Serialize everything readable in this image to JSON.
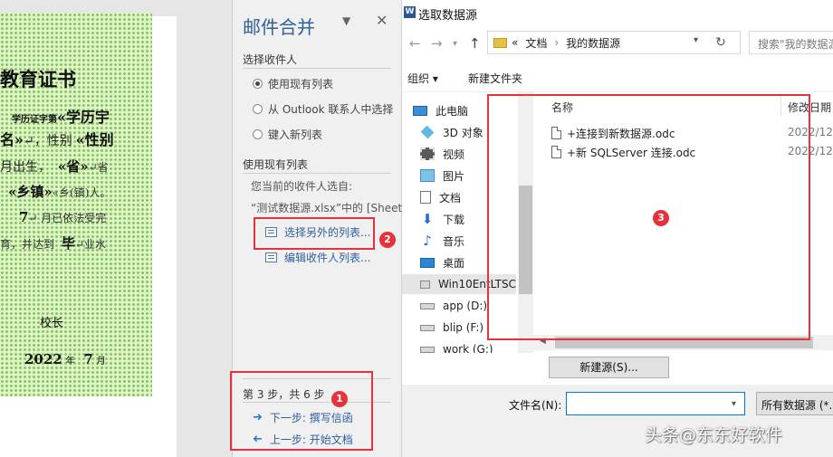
{
  "document": {
    "lines": [
      "教育证书",
      "学历证字第",
      "«学历宇",
      "名»",
      "↵，性别",
      "«性别",
      "月出生，",
      "«省»",
      "↵省",
      "«乡镇»",
      "«乡(镇)人。",
      "7",
      "↵ 月已依法受完",
      "育，并达到",
      "毕",
      "↵业水",
      "校长",
      "2022",
      "年",
      "7",
      "月"
    ]
  },
  "mail_merge": {
    "title": "邮件合并",
    "menu_icon": "chevron-down-icon",
    "close_label": "✕",
    "section_recipients": "选择收件人",
    "radio_options": [
      {
        "label": "使用现有列表",
        "selected": true
      },
      {
        "label": "从 Outlook 联系人中选择",
        "selected": false
      },
      {
        "label": "键入新列表",
        "selected": false
      }
    ],
    "section_existing": "使用现有列表",
    "current_from": "您当前的收件人选自:",
    "current_source": "“测试数据源.xlsx”中的 [Sheet1$",
    "select_other": "选择另外的列表...",
    "edit_list": "编辑收件人列表...",
    "step": "第 3 步，共 6 步",
    "next": "下一步: 撰写信函",
    "prev": "上一步: 开始文档"
  },
  "dialog": {
    "title": "选取数据源",
    "app_icon_letter": "W",
    "address": {
      "root": "«",
      "segments": [
        "文档",
        "我的数据源"
      ]
    },
    "search_placeholder": "搜索\"我的数据源\"",
    "organize": "组织 ▾",
    "new_folder": "新建文件夹",
    "tree": [
      {
        "label": "此电脑",
        "icon": "computer-icon",
        "level": 0
      },
      {
        "label": "3D 对象",
        "icon": "cube-icon",
        "level": 1
      },
      {
        "label": "视频",
        "icon": "video-icon",
        "level": 1
      },
      {
        "label": "图片",
        "icon": "image-icon",
        "level": 1
      },
      {
        "label": "文档",
        "icon": "document-icon",
        "level": 1
      },
      {
        "label": "下载",
        "icon": "download-icon",
        "level": 1
      },
      {
        "label": "音乐",
        "icon": "music-icon",
        "level": 1
      },
      {
        "label": "桌面",
        "icon": "desktop-icon",
        "level": 1
      },
      {
        "label": "Win10EntLTSC",
        "icon": "drive-icon",
        "level": 1,
        "selected": true
      },
      {
        "label": "app (D:)",
        "icon": "drive-icon",
        "level": 1
      },
      {
        "label": "blip (F:)",
        "icon": "drive-icon",
        "level": 1
      },
      {
        "label": "work (G:)",
        "icon": "drive-icon",
        "level": 1
      }
    ],
    "columns": {
      "name": "名称",
      "date": "修改日期"
    },
    "files": [
      {
        "name": "+连接到新数据源.odc",
        "date": "2022/12/"
      },
      {
        "name": "+新 SQLServer 连接.odc",
        "date": "2022/12/"
      }
    ],
    "new_source": "新建源(S)...",
    "filename_label": "文件名(N):",
    "filename_value": "",
    "filetype": "所有数据源 (*.o"
  },
  "annotations": [
    "1",
    "2",
    "3"
  ],
  "watermark": "头条@东东好软件",
  "colors": {
    "annotation": "#e5323b",
    "link": "#2e5e9e",
    "pane_title": "#2e5e9e",
    "doc_shade": "#dff5c4"
  }
}
